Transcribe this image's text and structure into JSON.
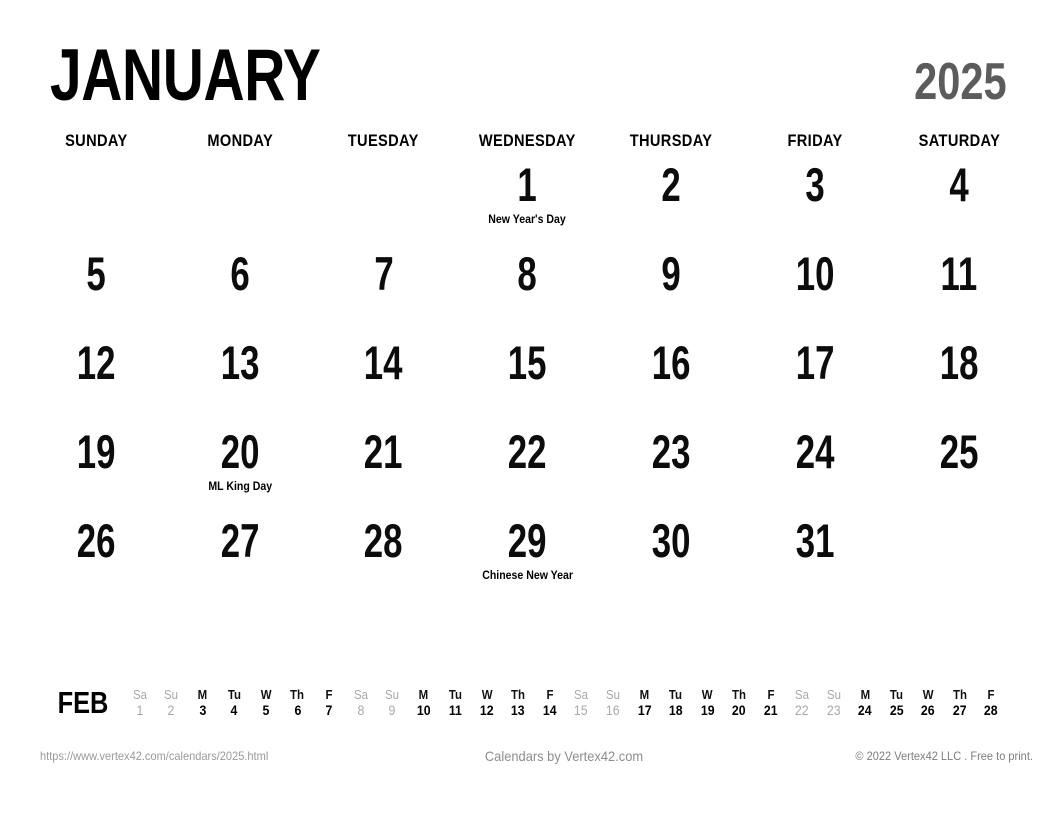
{
  "header": {
    "month": "JANUARY",
    "year": "2025",
    "year_color": "#5c5c5c"
  },
  "weekdays": [
    "SUNDAY",
    "MONDAY",
    "TUESDAY",
    "WEDNESDAY",
    "THURSDAY",
    "FRIDAY",
    "SATURDAY"
  ],
  "weeks": [
    [
      {
        "date": "",
        "event": ""
      },
      {
        "date": "",
        "event": ""
      },
      {
        "date": "",
        "event": ""
      },
      {
        "date": "1",
        "event": "New Year's Day"
      },
      {
        "date": "2",
        "event": ""
      },
      {
        "date": "3",
        "event": ""
      },
      {
        "date": "4",
        "event": ""
      }
    ],
    [
      {
        "date": "5",
        "event": ""
      },
      {
        "date": "6",
        "event": ""
      },
      {
        "date": "7",
        "event": ""
      },
      {
        "date": "8",
        "event": ""
      },
      {
        "date": "9",
        "event": ""
      },
      {
        "date": "10",
        "event": ""
      },
      {
        "date": "11",
        "event": ""
      }
    ],
    [
      {
        "date": "12",
        "event": ""
      },
      {
        "date": "13",
        "event": ""
      },
      {
        "date": "14",
        "event": ""
      },
      {
        "date": "15",
        "event": ""
      },
      {
        "date": "16",
        "event": ""
      },
      {
        "date": "17",
        "event": ""
      },
      {
        "date": "18",
        "event": ""
      }
    ],
    [
      {
        "date": "19",
        "event": ""
      },
      {
        "date": "20",
        "event": "ML King Day"
      },
      {
        "date": "21",
        "event": ""
      },
      {
        "date": "22",
        "event": ""
      },
      {
        "date": "23",
        "event": ""
      },
      {
        "date": "24",
        "event": ""
      },
      {
        "date": "25",
        "event": ""
      }
    ],
    [
      {
        "date": "26",
        "event": ""
      },
      {
        "date": "27",
        "event": ""
      },
      {
        "date": "28",
        "event": ""
      },
      {
        "date": "29",
        "event": "Chinese New Year"
      },
      {
        "date": "30",
        "event": ""
      },
      {
        "date": "31",
        "event": ""
      },
      {
        "date": "",
        "event": ""
      }
    ]
  ],
  "next_month": {
    "label": "FEB",
    "days": [
      {
        "dow": "Sa",
        "date": "1",
        "weekend": true
      },
      {
        "dow": "Su",
        "date": "2",
        "weekend": true
      },
      {
        "dow": "M",
        "date": "3",
        "weekend": false
      },
      {
        "dow": "Tu",
        "date": "4",
        "weekend": false
      },
      {
        "dow": "W",
        "date": "5",
        "weekend": false
      },
      {
        "dow": "Th",
        "date": "6",
        "weekend": false
      },
      {
        "dow": "F",
        "date": "7",
        "weekend": false
      },
      {
        "dow": "Sa",
        "date": "8",
        "weekend": true
      },
      {
        "dow": "Su",
        "date": "9",
        "weekend": true
      },
      {
        "dow": "M",
        "date": "10",
        "weekend": false
      },
      {
        "dow": "Tu",
        "date": "11",
        "weekend": false
      },
      {
        "dow": "W",
        "date": "12",
        "weekend": false
      },
      {
        "dow": "Th",
        "date": "13",
        "weekend": false
      },
      {
        "dow": "F",
        "date": "14",
        "weekend": false
      },
      {
        "dow": "Sa",
        "date": "15",
        "weekend": true
      },
      {
        "dow": "Su",
        "date": "16",
        "weekend": true
      },
      {
        "dow": "M",
        "date": "17",
        "weekend": false
      },
      {
        "dow": "Tu",
        "date": "18",
        "weekend": false
      },
      {
        "dow": "W",
        "date": "19",
        "weekend": false
      },
      {
        "dow": "Th",
        "date": "20",
        "weekend": false
      },
      {
        "dow": "F",
        "date": "21",
        "weekend": false
      },
      {
        "dow": "Sa",
        "date": "22",
        "weekend": true
      },
      {
        "dow": "Su",
        "date": "23",
        "weekend": true
      },
      {
        "dow": "M",
        "date": "24",
        "weekend": false
      },
      {
        "dow": "Tu",
        "date": "25",
        "weekend": false
      },
      {
        "dow": "W",
        "date": "26",
        "weekend": false
      },
      {
        "dow": "Th",
        "date": "27",
        "weekend": false
      },
      {
        "dow": "F",
        "date": "28",
        "weekend": false
      }
    ]
  },
  "footer": {
    "url": "https://www.vertex42.com/calendars/2025.html",
    "credit": "Calendars by Vertex42.com",
    "copyright": "© 2022 Vertex42 LLC . Free to print."
  }
}
